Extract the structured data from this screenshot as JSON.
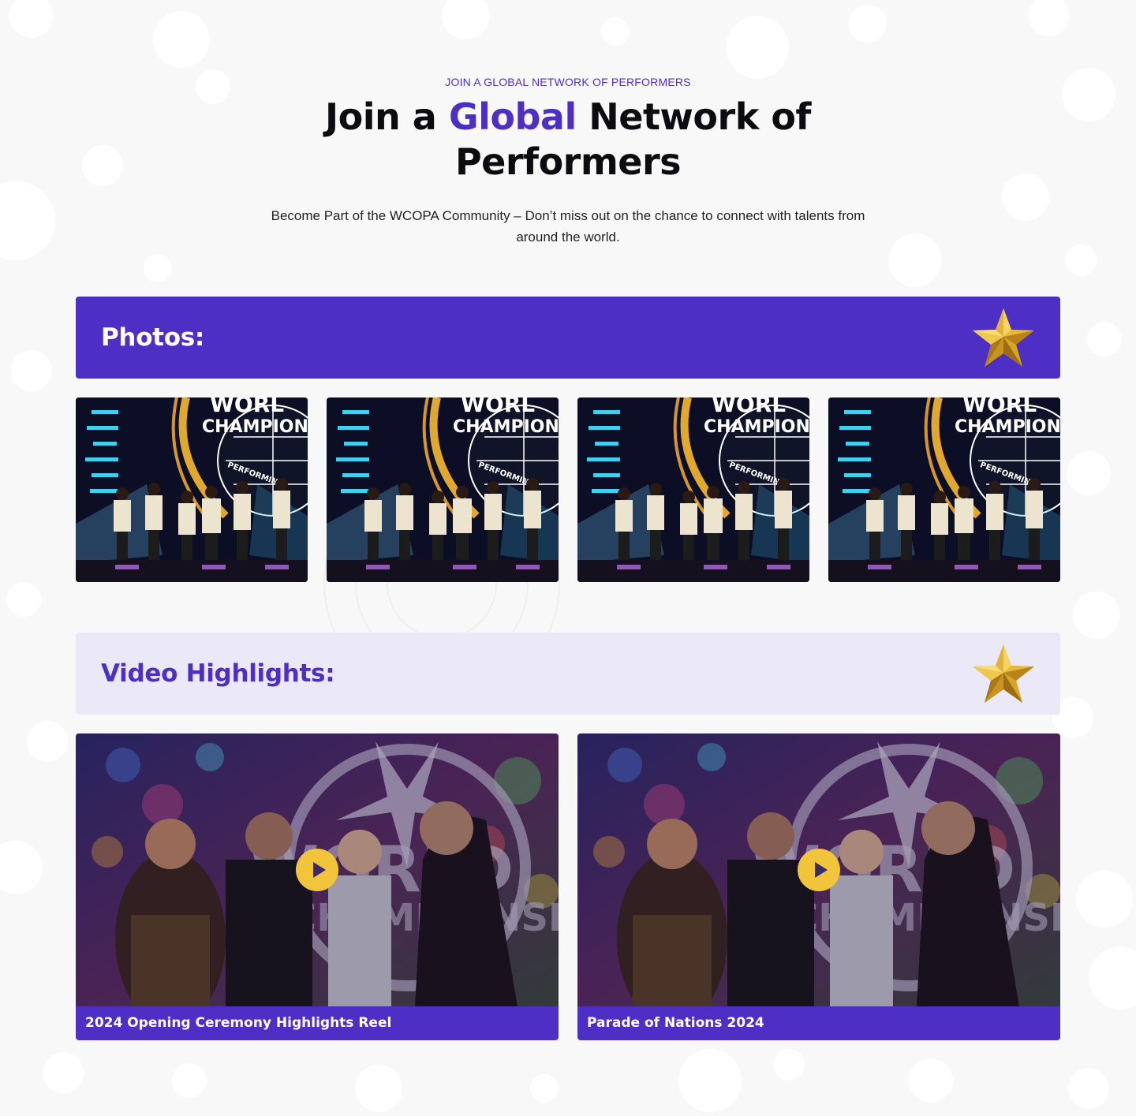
{
  "header": {
    "eyebrow": "JOIN A GLOBAL NETWORK OF PERFORMERS",
    "title_before": "Join a ",
    "title_accent": "Global",
    "title_after": " Network of Performers",
    "subtitle": "Become Part of the WCOPA Community –  Don’t miss out on the chance to connect with talents from around the world."
  },
  "photos": {
    "title": "Photos:",
    "items": [
      {
        "alt": "WORLD CHAMPIONSHIPS OF PERFORMING ARTS dance group on stage"
      },
      {
        "alt": "WORLD CHAMPIONSHIPS OF PERFORMING ARTS dance group on stage"
      },
      {
        "alt": "WORLD CHAMPIONSHIPS OF PERFORMING ARTS dance group on stage"
      },
      {
        "alt": "WORLD CHAMPIONSHIPS OF PERFORMING ARTS dance group on stage"
      }
    ],
    "stage_text": [
      "WORL",
      "CHAMPIONS",
      "PERFORMING"
    ]
  },
  "videos": {
    "title": "Video Highlights:",
    "items": [
      {
        "caption": "2024 Opening Ceremony Highlights Reel"
      },
      {
        "caption": "Parade of Nations 2024"
      }
    ]
  },
  "colors": {
    "brand_purple": "#4d2fc5",
    "light_purple": "#ebe8f7",
    "play_yellow": "#f2c43b",
    "star_gold": "#d9a92c"
  },
  "icons": {
    "section_icon": "star-icon",
    "play_icon": "play-icon"
  }
}
